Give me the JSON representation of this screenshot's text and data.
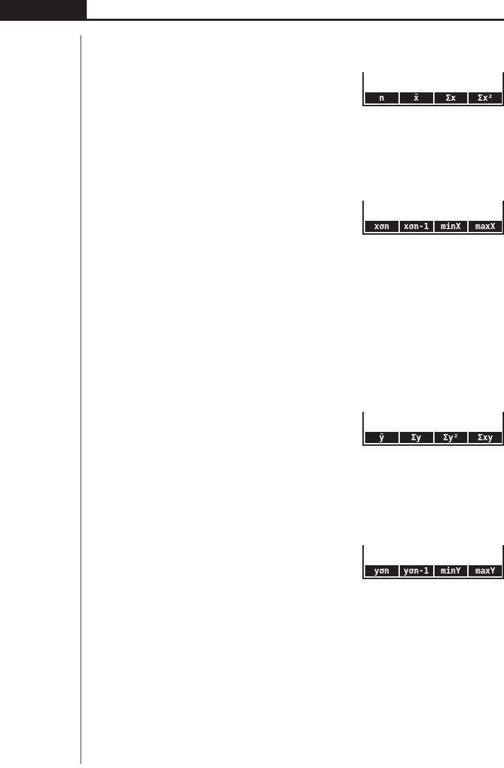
{
  "screens": [
    {
      "menu": [
        "n",
        "x̄",
        "Σx",
        "Σx²"
      ]
    },
    {
      "menu": [
        "xσn",
        "xσn-1",
        "minX",
        "maxX"
      ]
    },
    {
      "menu": [
        "ȳ",
        "Σy",
        "Σy²",
        "Σxy"
      ]
    },
    {
      "menu": [
        "yσn",
        "yσn-1",
        "minY",
        "maxY"
      ]
    }
  ]
}
